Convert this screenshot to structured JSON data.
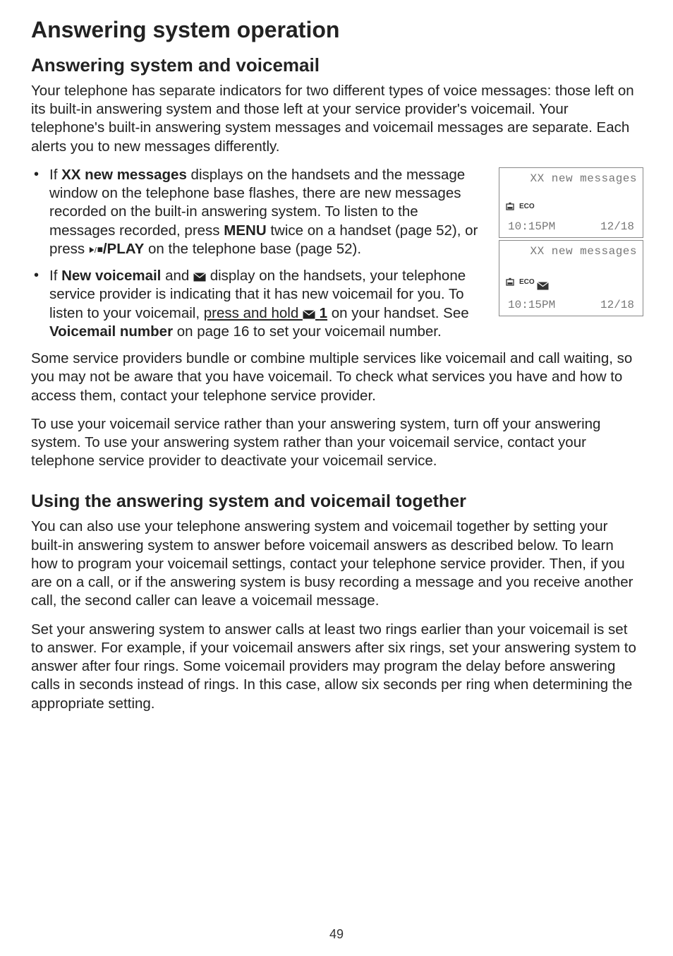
{
  "title": "Answering system operation",
  "subtitle": "Answering system and voicemail",
  "intro": "Your telephone has separate indicators for two different types of voice messages: those left on its built-in answering system and those left at your service provider's voicemail. Your telephone's built-in answering system messages and voicemail messages are separate. Each alerts you to new messages differently.",
  "bullet1": {
    "prefix": "If ",
    "bold1": "XX new messages",
    "mid1": " displays on the handsets and the message window on the telephone base flashes, there are new messages recorded on the built-in answering system. To listen to the messages recorded, press ",
    "bold2": "MENU",
    "mid2": " twice on a handset (page 52), or press ",
    "bold3": "/PLAY",
    "suffix": " on the telephone base (page 52)."
  },
  "bullet2": {
    "prefix": "If ",
    "bold1": "New voicemail",
    "mid1": " and ",
    "mid2": " display on the handsets, your telephone service provider is indicating that it has new voicemail for you. To listen to your voicemail, ",
    "underlined_pre": "press and hold ",
    "underlined_bold": "1",
    "mid3": " on your handset. See ",
    "bold2": "Voicemail number",
    "suffix": " on page 16 to set your voicemail number."
  },
  "para_after_bullets": "Some service providers bundle or combine multiple services like voicemail and call waiting, so you may not be aware that you have voicemail. To check what services you have and how to access them, contact your telephone service provider.",
  "para_after2": "To use your voicemail service rather than your answering system, turn off your answering system. To use your answering system rather than your voicemail service, contact your telephone service provider to deactivate your voicemail service.",
  "section2_title": "Using the answering system and voicemail together",
  "section2_p1": "You can also use your telephone answering system and voicemail together by setting your built-in answering system to answer before voicemail answers as described below. To learn how to program your voicemail settings, contact your telephone service provider. Then, if you are on a call, or if the answering system is busy recording a message and you receive another call, the second caller can leave a voicemail message.",
  "section2_p2": "Set your answering system to answer calls at least two rings earlier than your voicemail is set to answer. For example, if your voicemail answers after six rings, set your answering system to answer after four rings. Some voicemail providers may program the delay before answering calls in seconds instead of rings. In this case, allow six seconds per ring when determining the appropriate setting.",
  "lcd1": {
    "top": "XX new messages",
    "eco": "ECO",
    "time": "10:15PM",
    "date": "12/18"
  },
  "lcd2": {
    "top": "XX new messages",
    "eco": "ECO",
    "time": "10:15PM",
    "date": "12/18"
  },
  "page_number": "49",
  "icons": {
    "envelope": "envelope-icon",
    "battery": "battery-icon",
    "play_stop": "play-stop-icon"
  }
}
